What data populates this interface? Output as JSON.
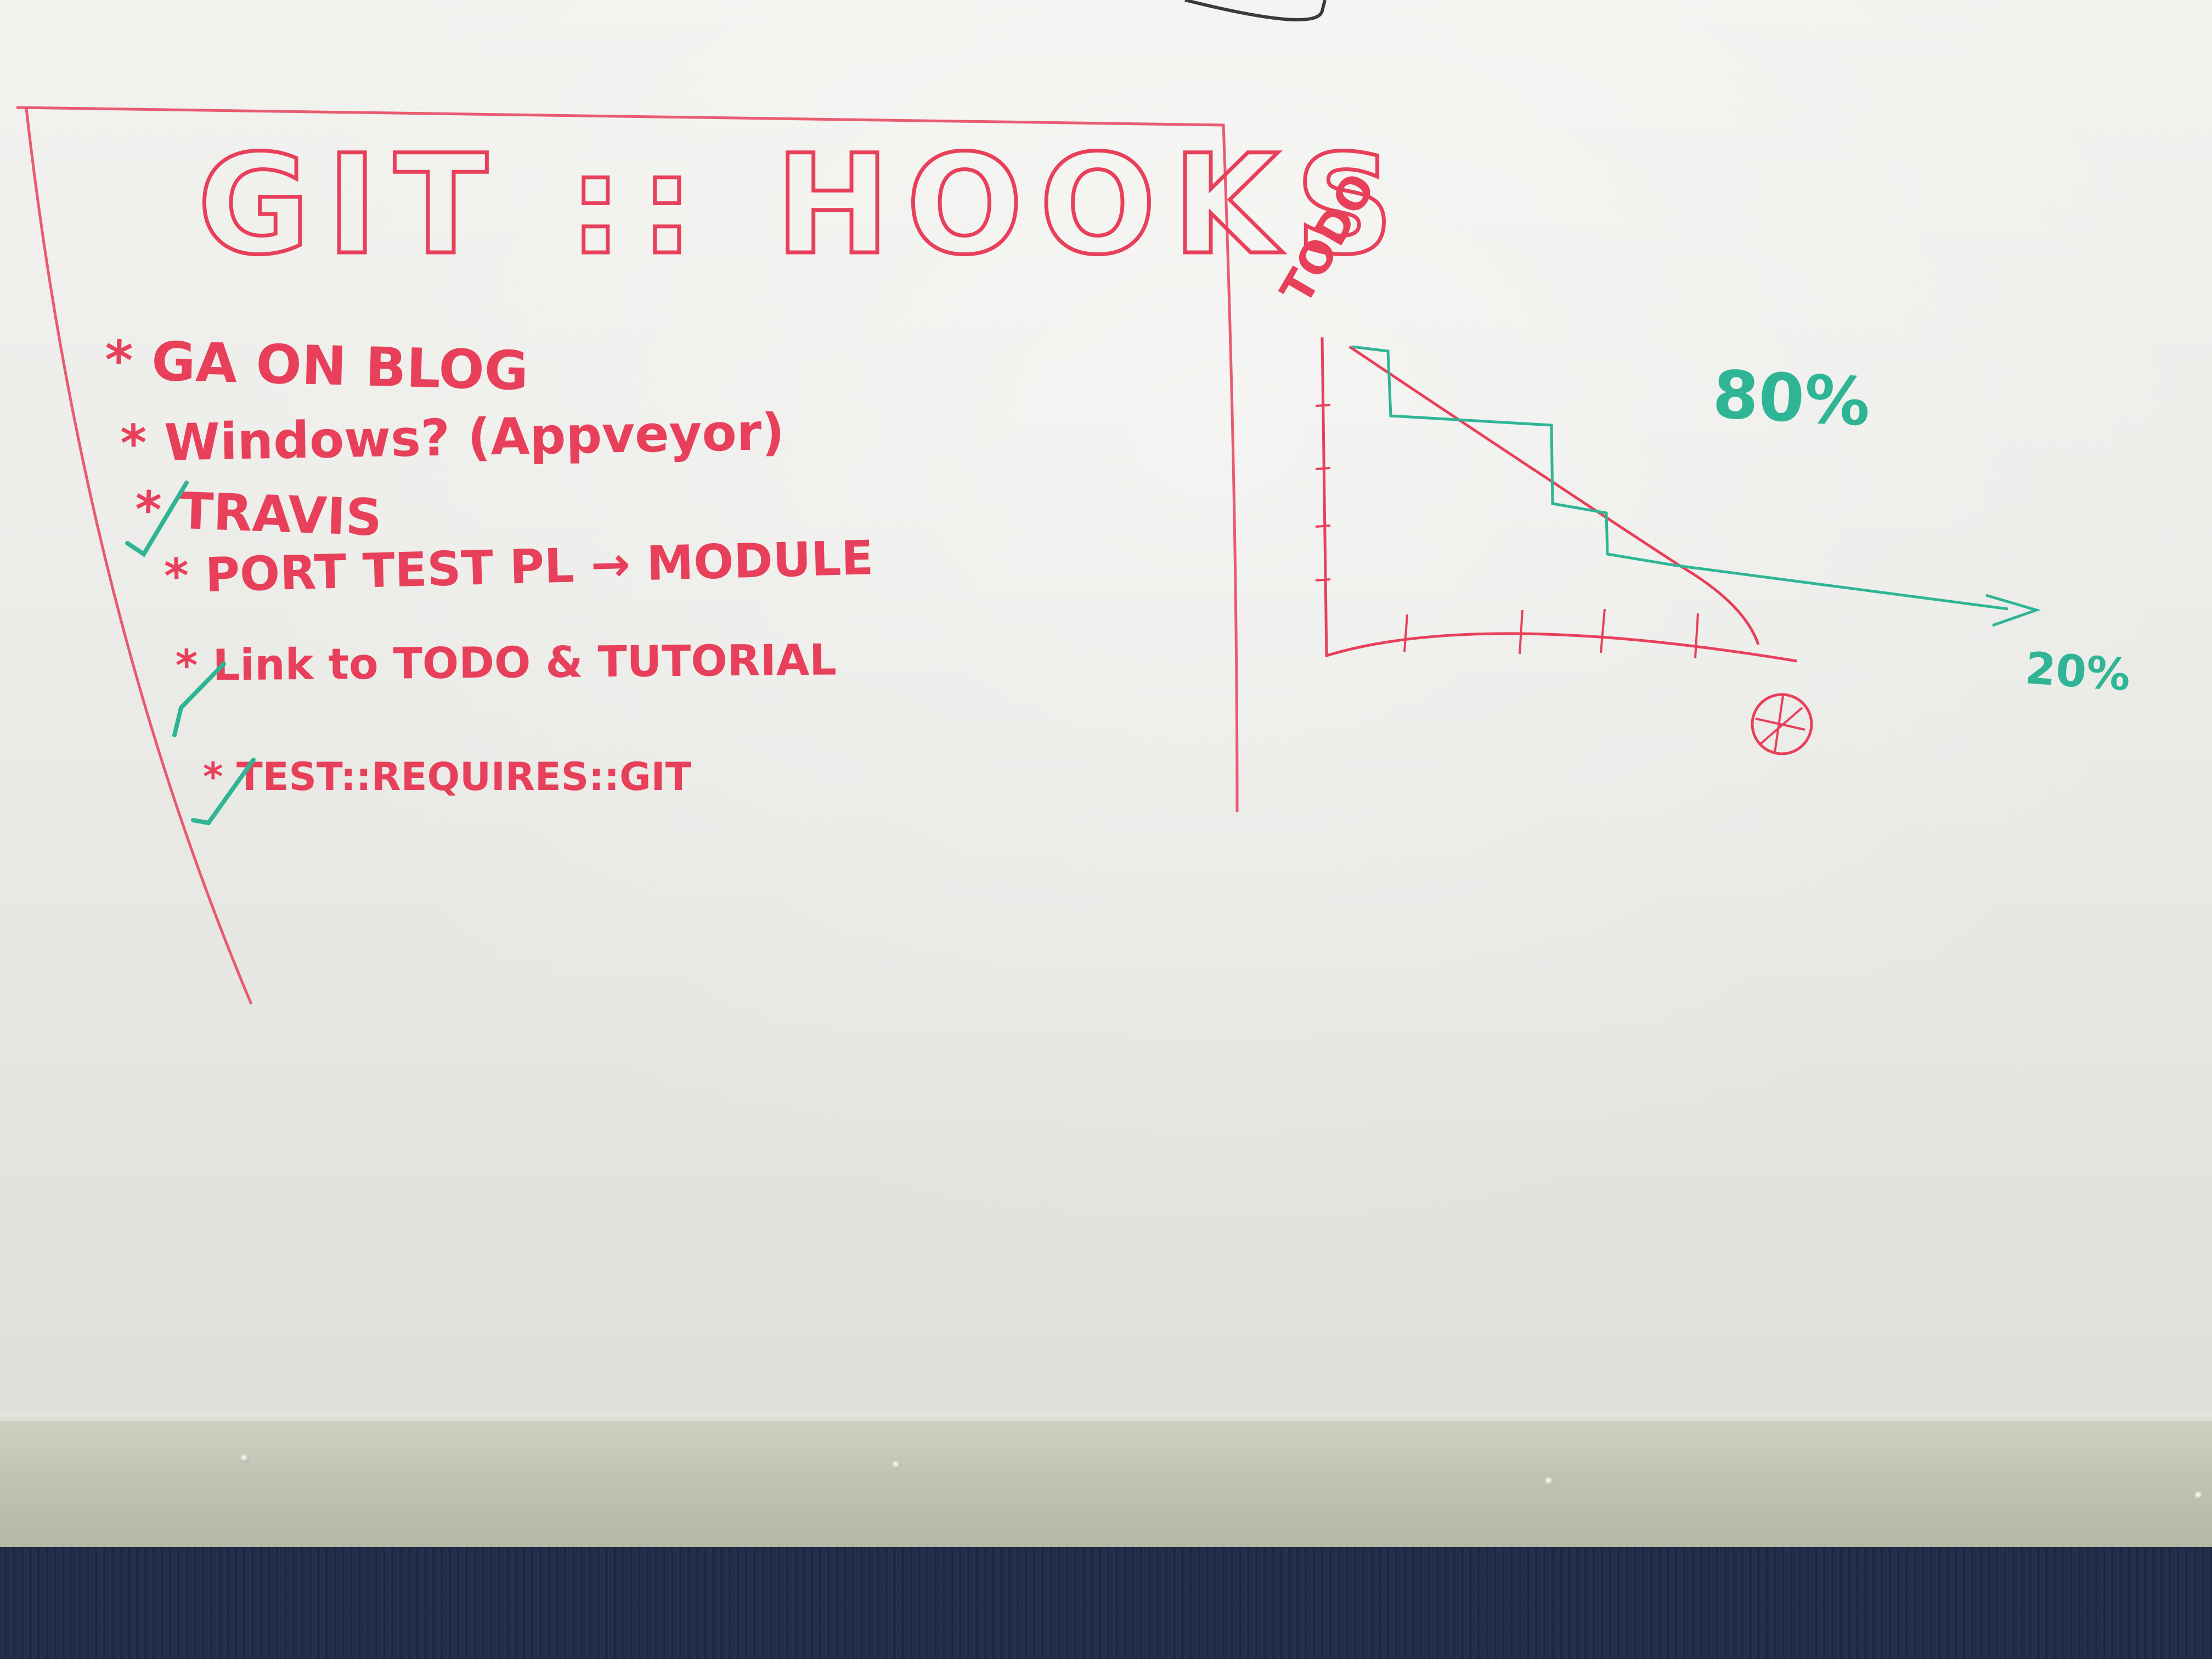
{
  "whiteboard": {
    "title": "GIT :: HOOKS",
    "list": [
      {
        "text": "* GA ON BLOG",
        "checked": false
      },
      {
        "text": "* Windows? (Appveyor)",
        "checked": false
      },
      {
        "text": "* TRAVIS",
        "checked": true
      },
      {
        "text": "* PORT TEST PL → MODULE",
        "checked": false
      },
      {
        "text": "* Link to TODO & TUTORIAL",
        "checked": true
      },
      {
        "text": "* TEST::REQUIRES::GIT",
        "checked": true
      }
    ]
  },
  "sketch": {
    "y_axis_label": "TODO",
    "upper_annotation": "80%",
    "lower_annotation": "20%",
    "colors": {
      "red_marker": "#e8405a",
      "green_marker": "#2fb596"
    }
  }
}
